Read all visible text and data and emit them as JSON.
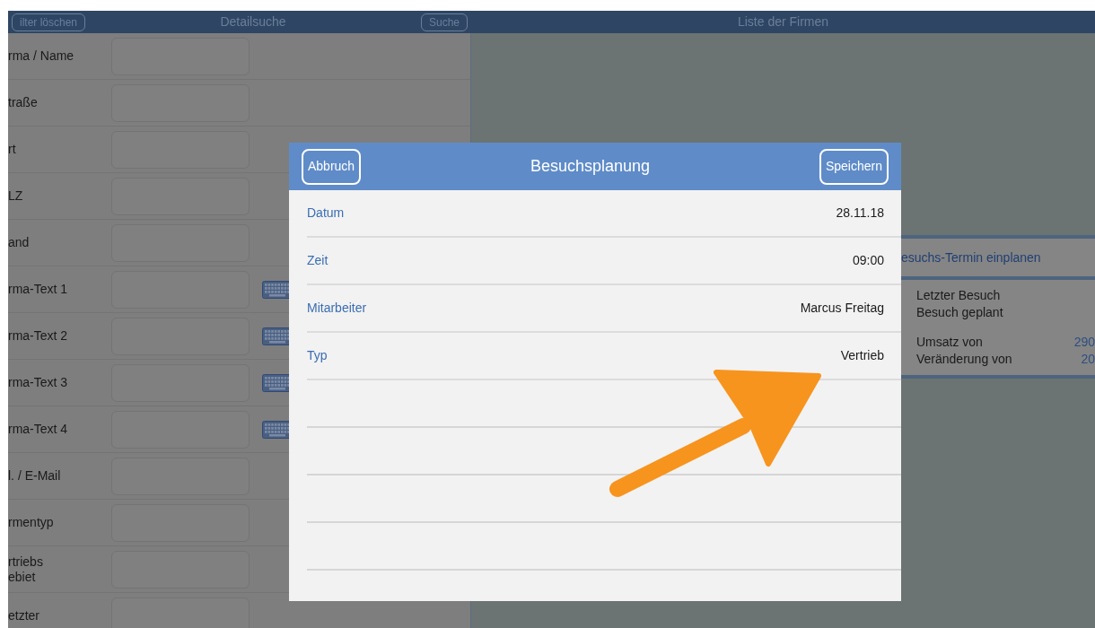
{
  "top_bar": {
    "left_button": "ilter löschen",
    "left_title": "Detailsuche",
    "right_button": "Suche",
    "right_title": "Liste der Firmen"
  },
  "search_form": {
    "rows": [
      {
        "label": "rma / Name",
        "keyboard": false
      },
      {
        "label": "traße",
        "keyboard": false
      },
      {
        "label": "rt",
        "keyboard": false
      },
      {
        "label": "LZ",
        "keyboard": false
      },
      {
        "label": "and",
        "keyboard": false
      },
      {
        "label": "rma-Text 1",
        "keyboard": true
      },
      {
        "label": "rma-Text 2",
        "keyboard": true
      },
      {
        "label": "rma-Text 3",
        "keyboard": true
      },
      {
        "label": "rma-Text 4",
        "keyboard": true
      },
      {
        "label": "l. / E-Mail",
        "keyboard": false
      },
      {
        "label": "rmentyp",
        "keyboard": false
      },
      {
        "label": "rtriebs\nebiet",
        "keyboard": false
      },
      {
        "label": "etzter",
        "keyboard": false
      }
    ]
  },
  "map_card": {
    "action": "esuchs-Termin einplanen",
    "lines": [
      {
        "label": "Letzter Besuch"
      },
      {
        "label": "Besuch geplant"
      },
      {
        "label": "Umsatz von",
        "value": "290"
      },
      {
        "label": "Veränderung von",
        "value": "20"
      }
    ]
  },
  "dialog": {
    "title": "Besuchsplanung",
    "cancel": "Abbruch",
    "save": "Speichern",
    "rows": [
      {
        "kind": "field",
        "label": "Datum",
        "value": "28.11.18"
      },
      {
        "kind": "field",
        "label": "Zeit",
        "value": "09:00"
      },
      {
        "kind": "field",
        "label": "Mitarbeiter",
        "value": "Marcus Freitag"
      },
      {
        "kind": "field",
        "label": "Typ",
        "value": "Vertrieb"
      },
      {
        "kind": "blank"
      },
      {
        "kind": "blank"
      },
      {
        "kind": "blank"
      },
      {
        "kind": "blank"
      }
    ]
  }
}
